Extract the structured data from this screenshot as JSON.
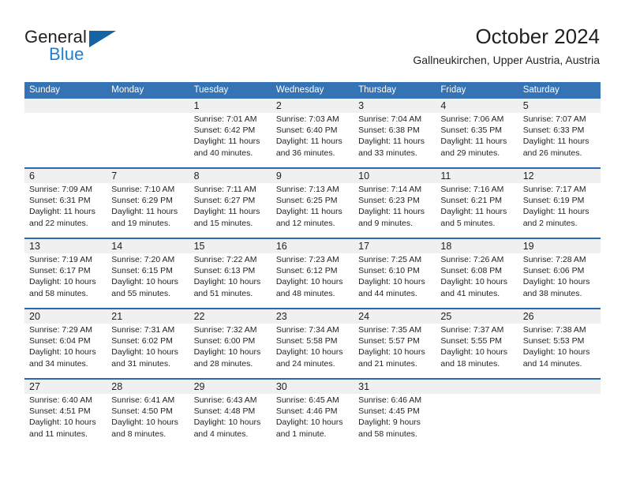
{
  "brand": {
    "line1": "General",
    "line2": "Blue",
    "logo_icon": "triangle-logo-mark",
    "accent_color": "#1b7fd4",
    "mark_color": "#1464a5"
  },
  "header": {
    "title": "October 2024",
    "subtitle": "Gallneukirchen, Upper Austria, Austria"
  },
  "theme": {
    "header_blue": "#3573b4",
    "row_border_blue": "#2a6aad",
    "daynum_band": "#f0f0f0"
  },
  "weekdays": [
    "Sunday",
    "Monday",
    "Tuesday",
    "Wednesday",
    "Thursday",
    "Friday",
    "Saturday"
  ],
  "labels": {
    "sunrise": "Sunrise:",
    "sunset": "Sunset:",
    "daylight": "Daylight:"
  },
  "weeks": [
    [
      {
        "day": "",
        "sunrise": "",
        "sunset": "",
        "daylight": ""
      },
      {
        "day": "",
        "sunrise": "",
        "sunset": "",
        "daylight": ""
      },
      {
        "day": "1",
        "sunrise": "Sunrise: 7:01 AM",
        "sunset": "Sunset: 6:42 PM",
        "daylight": "Daylight: 11 hours and 40 minutes."
      },
      {
        "day": "2",
        "sunrise": "Sunrise: 7:03 AM",
        "sunset": "Sunset: 6:40 PM",
        "daylight": "Daylight: 11 hours and 36 minutes."
      },
      {
        "day": "3",
        "sunrise": "Sunrise: 7:04 AM",
        "sunset": "Sunset: 6:38 PM",
        "daylight": "Daylight: 11 hours and 33 minutes."
      },
      {
        "day": "4",
        "sunrise": "Sunrise: 7:06 AM",
        "sunset": "Sunset: 6:35 PM",
        "daylight": "Daylight: 11 hours and 29 minutes."
      },
      {
        "day": "5",
        "sunrise": "Sunrise: 7:07 AM",
        "sunset": "Sunset: 6:33 PM",
        "daylight": "Daylight: 11 hours and 26 minutes."
      }
    ],
    [
      {
        "day": "6",
        "sunrise": "Sunrise: 7:09 AM",
        "sunset": "Sunset: 6:31 PM",
        "daylight": "Daylight: 11 hours and 22 minutes."
      },
      {
        "day": "7",
        "sunrise": "Sunrise: 7:10 AM",
        "sunset": "Sunset: 6:29 PM",
        "daylight": "Daylight: 11 hours and 19 minutes."
      },
      {
        "day": "8",
        "sunrise": "Sunrise: 7:11 AM",
        "sunset": "Sunset: 6:27 PM",
        "daylight": "Daylight: 11 hours and 15 minutes."
      },
      {
        "day": "9",
        "sunrise": "Sunrise: 7:13 AM",
        "sunset": "Sunset: 6:25 PM",
        "daylight": "Daylight: 11 hours and 12 minutes."
      },
      {
        "day": "10",
        "sunrise": "Sunrise: 7:14 AM",
        "sunset": "Sunset: 6:23 PM",
        "daylight": "Daylight: 11 hours and 9 minutes."
      },
      {
        "day": "11",
        "sunrise": "Sunrise: 7:16 AM",
        "sunset": "Sunset: 6:21 PM",
        "daylight": "Daylight: 11 hours and 5 minutes."
      },
      {
        "day": "12",
        "sunrise": "Sunrise: 7:17 AM",
        "sunset": "Sunset: 6:19 PM",
        "daylight": "Daylight: 11 hours and 2 minutes."
      }
    ],
    [
      {
        "day": "13",
        "sunrise": "Sunrise: 7:19 AM",
        "sunset": "Sunset: 6:17 PM",
        "daylight": "Daylight: 10 hours and 58 minutes."
      },
      {
        "day": "14",
        "sunrise": "Sunrise: 7:20 AM",
        "sunset": "Sunset: 6:15 PM",
        "daylight": "Daylight: 10 hours and 55 minutes."
      },
      {
        "day": "15",
        "sunrise": "Sunrise: 7:22 AM",
        "sunset": "Sunset: 6:13 PM",
        "daylight": "Daylight: 10 hours and 51 minutes."
      },
      {
        "day": "16",
        "sunrise": "Sunrise: 7:23 AM",
        "sunset": "Sunset: 6:12 PM",
        "daylight": "Daylight: 10 hours and 48 minutes."
      },
      {
        "day": "17",
        "sunrise": "Sunrise: 7:25 AM",
        "sunset": "Sunset: 6:10 PM",
        "daylight": "Daylight: 10 hours and 44 minutes."
      },
      {
        "day": "18",
        "sunrise": "Sunrise: 7:26 AM",
        "sunset": "Sunset: 6:08 PM",
        "daylight": "Daylight: 10 hours and 41 minutes."
      },
      {
        "day": "19",
        "sunrise": "Sunrise: 7:28 AM",
        "sunset": "Sunset: 6:06 PM",
        "daylight": "Daylight: 10 hours and 38 minutes."
      }
    ],
    [
      {
        "day": "20",
        "sunrise": "Sunrise: 7:29 AM",
        "sunset": "Sunset: 6:04 PM",
        "daylight": "Daylight: 10 hours and 34 minutes."
      },
      {
        "day": "21",
        "sunrise": "Sunrise: 7:31 AM",
        "sunset": "Sunset: 6:02 PM",
        "daylight": "Daylight: 10 hours and 31 minutes."
      },
      {
        "day": "22",
        "sunrise": "Sunrise: 7:32 AM",
        "sunset": "Sunset: 6:00 PM",
        "daylight": "Daylight: 10 hours and 28 minutes."
      },
      {
        "day": "23",
        "sunrise": "Sunrise: 7:34 AM",
        "sunset": "Sunset: 5:58 PM",
        "daylight": "Daylight: 10 hours and 24 minutes."
      },
      {
        "day": "24",
        "sunrise": "Sunrise: 7:35 AM",
        "sunset": "Sunset: 5:57 PM",
        "daylight": "Daylight: 10 hours and 21 minutes."
      },
      {
        "day": "25",
        "sunrise": "Sunrise: 7:37 AM",
        "sunset": "Sunset: 5:55 PM",
        "daylight": "Daylight: 10 hours and 18 minutes."
      },
      {
        "day": "26",
        "sunrise": "Sunrise: 7:38 AM",
        "sunset": "Sunset: 5:53 PM",
        "daylight": "Daylight: 10 hours and 14 minutes."
      }
    ],
    [
      {
        "day": "27",
        "sunrise": "Sunrise: 6:40 AM",
        "sunset": "Sunset: 4:51 PM",
        "daylight": "Daylight: 10 hours and 11 minutes."
      },
      {
        "day": "28",
        "sunrise": "Sunrise: 6:41 AM",
        "sunset": "Sunset: 4:50 PM",
        "daylight": "Daylight: 10 hours and 8 minutes."
      },
      {
        "day": "29",
        "sunrise": "Sunrise: 6:43 AM",
        "sunset": "Sunset: 4:48 PM",
        "daylight": "Daylight: 10 hours and 4 minutes."
      },
      {
        "day": "30",
        "sunrise": "Sunrise: 6:45 AM",
        "sunset": "Sunset: 4:46 PM",
        "daylight": "Daylight: 10 hours and 1 minute."
      },
      {
        "day": "31",
        "sunrise": "Sunrise: 6:46 AM",
        "sunset": "Sunset: 4:45 PM",
        "daylight": "Daylight: 9 hours and 58 minutes."
      },
      {
        "day": "",
        "sunrise": "",
        "sunset": "",
        "daylight": ""
      },
      {
        "day": "",
        "sunrise": "",
        "sunset": "",
        "daylight": ""
      }
    ]
  ]
}
